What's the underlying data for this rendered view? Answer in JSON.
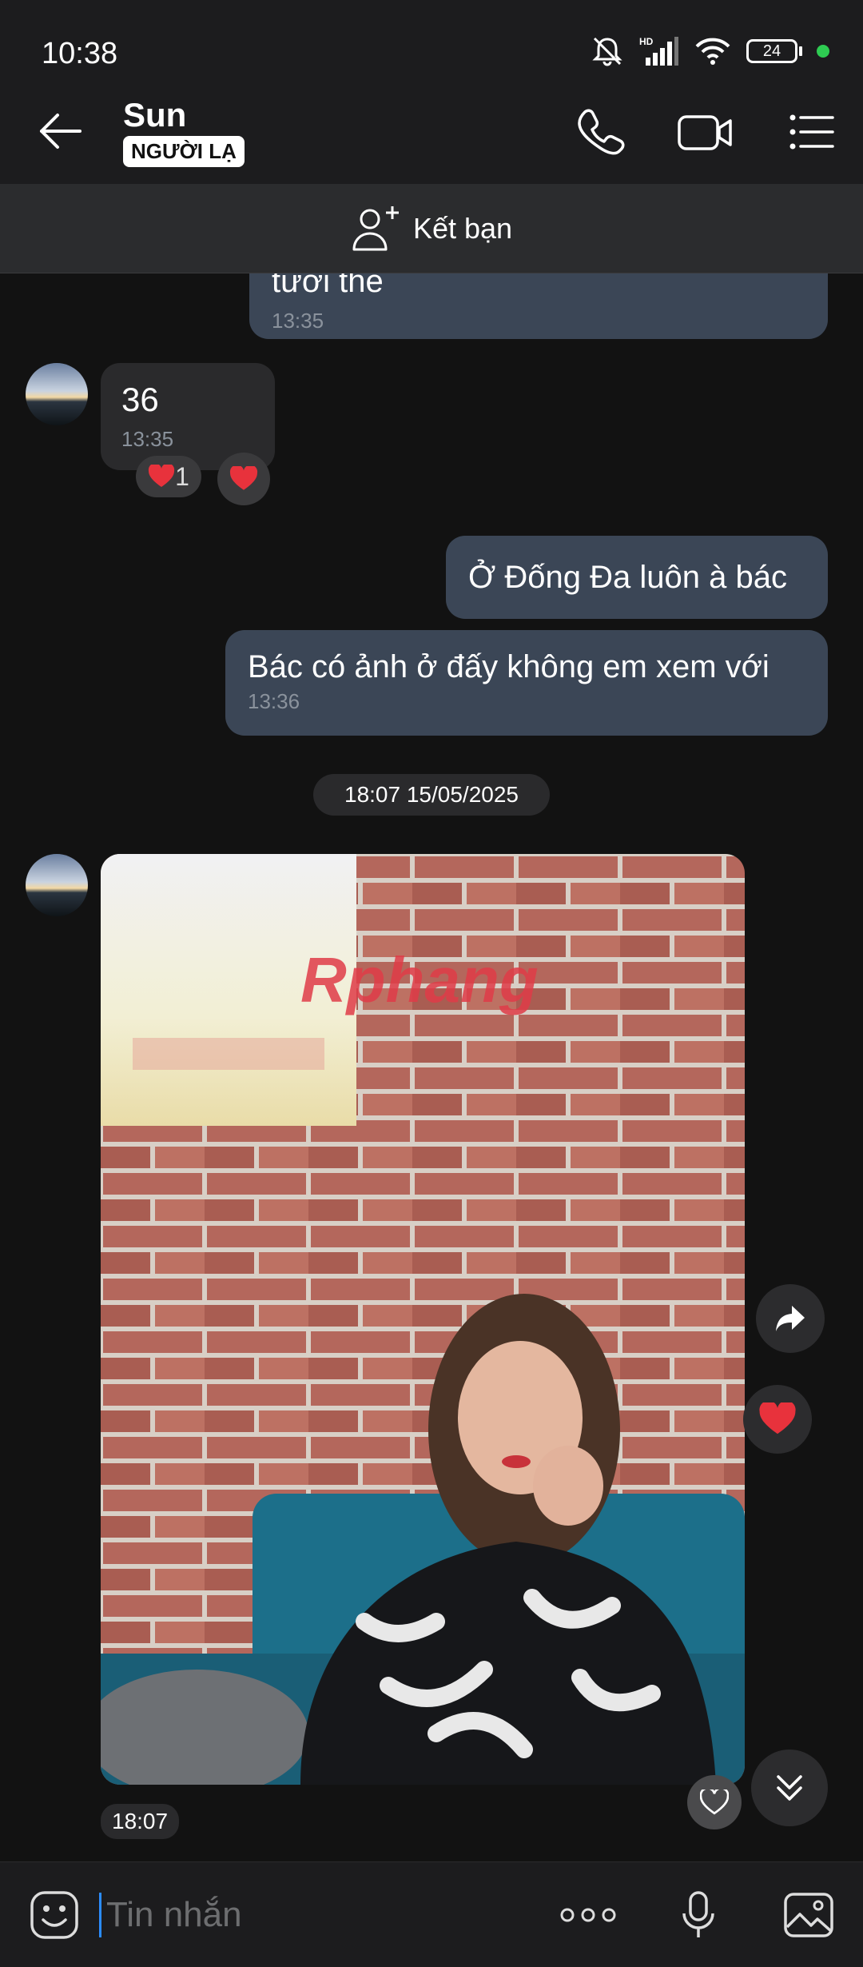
{
  "status_bar": {
    "time": "10:38",
    "battery": "24",
    "signal_label": "HD"
  },
  "header": {
    "contact_name": "Sun",
    "badge": "NGƯỜI LẠ"
  },
  "add_friend": {
    "label": "Kết bạn"
  },
  "messages": [
    {
      "direction": "out",
      "text": "tươi thế",
      "time": "13:35"
    },
    {
      "direction": "in",
      "text": "36",
      "time": "13:35",
      "reaction_count": "1"
    },
    {
      "direction": "out",
      "text": "Ở Đống Đa luôn à bác"
    },
    {
      "direction": "out",
      "text": "Bác có ảnh ở đấy không em xem với",
      "time": "13:36"
    }
  ],
  "date_separator": "18:07 15/05/2025",
  "photo": {
    "time": "18:07",
    "watermark": "Rphang"
  },
  "input": {
    "placeholder": "Tin nhắn"
  },
  "colors": {
    "accent": "#2b8cff",
    "bubble_out": "#3b4656",
    "bubble_in": "#2a2a2c",
    "heart": "#e8323c"
  }
}
